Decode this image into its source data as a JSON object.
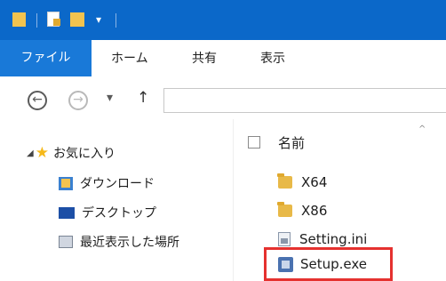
{
  "ribbon": {
    "tabs": [
      "ファイル",
      "ホーム",
      "共有",
      "表示"
    ]
  },
  "nav": {
    "back_glyph": "←",
    "forward_glyph": "→",
    "dropdown_glyph": "▾",
    "up_glyph": "↑"
  },
  "navpane": {
    "favorites_label": "お気に入り",
    "items": [
      "ダウンロード",
      "デスクトップ",
      "最近表示した場所"
    ]
  },
  "content": {
    "column_name": "名前",
    "sort_glyph": "^",
    "files": [
      "X64",
      "X86",
      "Setting.ini",
      "Setup.exe"
    ]
  },
  "colors": {
    "titlebar": "#0b68c9",
    "file_tab": "#1979d8",
    "highlight": "#e5312f",
    "folder": "#e8b948"
  }
}
